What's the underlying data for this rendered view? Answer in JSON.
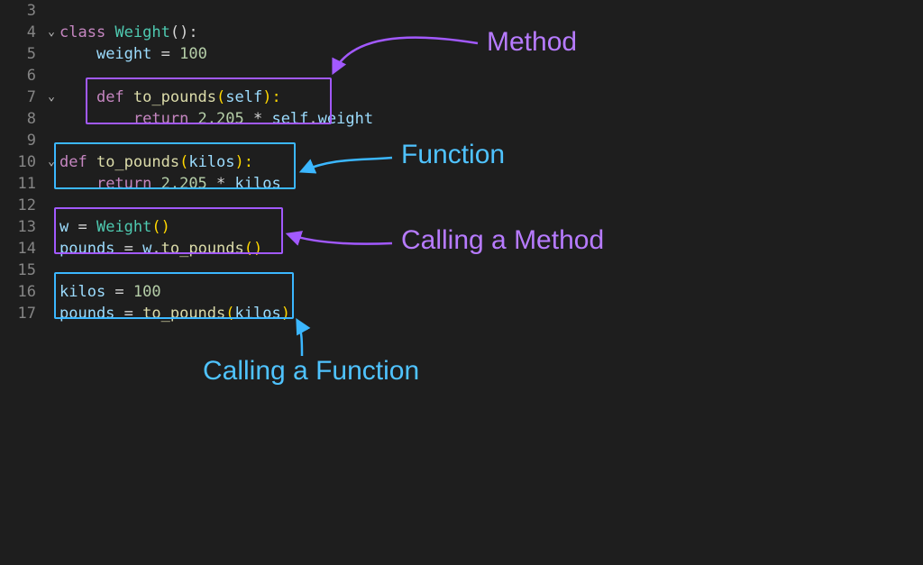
{
  "editor": {
    "lines": [
      {
        "num": "3",
        "fold": "",
        "tokens": []
      },
      {
        "num": "4",
        "fold": "⌄",
        "tokens": [
          {
            "t": "class ",
            "c": "kw"
          },
          {
            "t": "Weight",
            "c": "cls"
          },
          {
            "t": "():",
            "c": "op"
          }
        ]
      },
      {
        "num": "5",
        "fold": "",
        "tokens": [
          {
            "t": "    ",
            "c": ""
          },
          {
            "t": "weight",
            "c": "var"
          },
          {
            "t": " = ",
            "c": "op"
          },
          {
            "t": "100",
            "c": "num"
          }
        ]
      },
      {
        "num": "6",
        "fold": "",
        "tokens": []
      },
      {
        "num": "7",
        "fold": "⌄",
        "tokens": [
          {
            "t": "    ",
            "c": ""
          },
          {
            "t": "def ",
            "c": "kw"
          },
          {
            "t": "to_pounds",
            "c": "fn"
          },
          {
            "t": "(",
            "c": "paren"
          },
          {
            "t": "self",
            "c": "self"
          },
          {
            "t": "):",
            "c": "paren"
          }
        ]
      },
      {
        "num": "8",
        "fold": "",
        "tokens": [
          {
            "t": "        ",
            "c": ""
          },
          {
            "t": "return ",
            "c": "kw"
          },
          {
            "t": "2.205",
            "c": "num"
          },
          {
            "t": " * ",
            "c": "op"
          },
          {
            "t": "self",
            "c": "self"
          },
          {
            "t": ".",
            "c": "op"
          },
          {
            "t": "weight",
            "c": "var"
          }
        ]
      },
      {
        "num": "9",
        "fold": "",
        "tokens": []
      },
      {
        "num": "10",
        "fold": "⌄",
        "tokens": [
          {
            "t": "def ",
            "c": "kw"
          },
          {
            "t": "to_pounds",
            "c": "fn"
          },
          {
            "t": "(",
            "c": "paren"
          },
          {
            "t": "kilos",
            "c": "var"
          },
          {
            "t": "):",
            "c": "paren"
          }
        ]
      },
      {
        "num": "11",
        "fold": "",
        "tokens": [
          {
            "t": "    ",
            "c": ""
          },
          {
            "t": "return ",
            "c": "kw"
          },
          {
            "t": "2.205",
            "c": "num"
          },
          {
            "t": " * ",
            "c": "op"
          },
          {
            "t": "kilos",
            "c": "var"
          }
        ]
      },
      {
        "num": "12",
        "fold": "",
        "tokens": []
      },
      {
        "num": "13",
        "fold": "",
        "tokens": [
          {
            "t": "w",
            "c": "var"
          },
          {
            "t": " = ",
            "c": "op"
          },
          {
            "t": "Weight",
            "c": "cls"
          },
          {
            "t": "()",
            "c": "paren"
          }
        ]
      },
      {
        "num": "14",
        "fold": "",
        "tokens": [
          {
            "t": "pounds",
            "c": "var"
          },
          {
            "t": " = ",
            "c": "op"
          },
          {
            "t": "w",
            "c": "var"
          },
          {
            "t": ".",
            "c": "op"
          },
          {
            "t": "to_pounds",
            "c": "fn"
          },
          {
            "t": "()",
            "c": "paren"
          }
        ]
      },
      {
        "num": "15",
        "fold": "",
        "tokens": []
      },
      {
        "num": "16",
        "fold": "",
        "tokens": [
          {
            "t": "kilos",
            "c": "var"
          },
          {
            "t": " = ",
            "c": "op"
          },
          {
            "t": "100",
            "c": "num"
          }
        ]
      },
      {
        "num": "17",
        "fold": "",
        "tokens": [
          {
            "t": "pounds",
            "c": "var"
          },
          {
            "t": " = ",
            "c": "op"
          },
          {
            "t": "to_pounds",
            "c": "fn"
          },
          {
            "t": "(",
            "c": "paren"
          },
          {
            "t": "kilos",
            "c": "var"
          },
          {
            "t": ")",
            "c": "paren"
          }
        ]
      }
    ]
  },
  "annotations": {
    "methodLabel": "Method",
    "functionLabel": "Function",
    "callingMethodLabel": "Calling a Method",
    "callingFunctionLabel": "Calling a Function"
  },
  "colors": {
    "purple": "#a259ff",
    "blue": "#3bb7ff",
    "bg": "#1e1e1e"
  }
}
